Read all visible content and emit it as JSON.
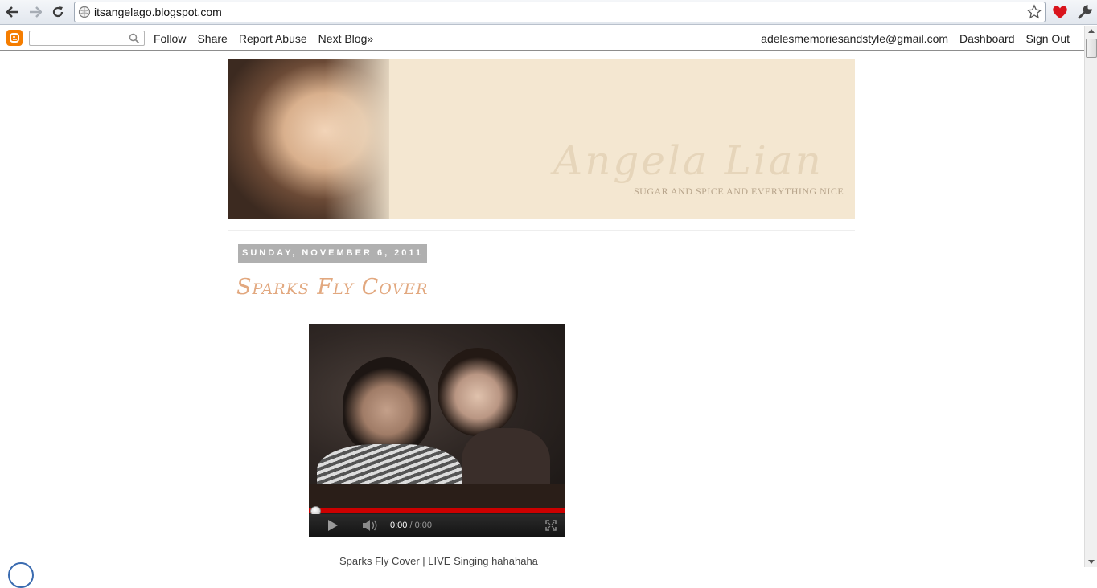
{
  "browser": {
    "url": "itsangelago.blogspot.com"
  },
  "navbar": {
    "search_placeholder": "",
    "links": [
      "Follow",
      "Share",
      "Report Abuse",
      "Next Blog»"
    ],
    "account_email": "adelesmemoriesandstyle@gmail.com",
    "dashboard_label": "Dashboard",
    "signout_label": "Sign Out"
  },
  "header": {
    "blog_title": "Angela Lian",
    "tagline": "SUGAR AND SPICE AND EVERYTHING NICE"
  },
  "post": {
    "date": "SUNDAY, NOVEMBER 6, 2011",
    "title": "Sparks Fly Cover",
    "video": {
      "current_time": "0:00",
      "separator": " / ",
      "duration": "0:00",
      "progress_color": "#cc0000"
    },
    "caption": "Sparks Fly Cover | LIVE Singing hahahaha"
  },
  "colors": {
    "banner_bg": "#f4e7d1",
    "post_title": "#e2a87f",
    "date_bg": "#b0b0b0",
    "blogger_orange": "#f57d00"
  }
}
